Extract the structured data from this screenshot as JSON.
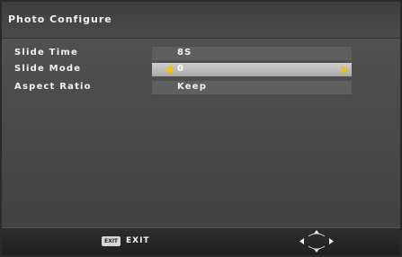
{
  "title": "Photo Configure",
  "menu_items": [
    {
      "label": "Slide Time",
      "value": "8S"
    },
    {
      "label": "Slide Mode",
      "value": "0"
    },
    {
      "label": "Aspect Ratio",
      "value": "Keep"
    }
  ],
  "footer": {
    "exit_key": "EXIT",
    "exit_label": "EXIT",
    "nav_icon": "directional-pad-icon"
  },
  "colors": {
    "arrow": "#f2c400",
    "selected_value_bg": "#bdbdbd"
  }
}
